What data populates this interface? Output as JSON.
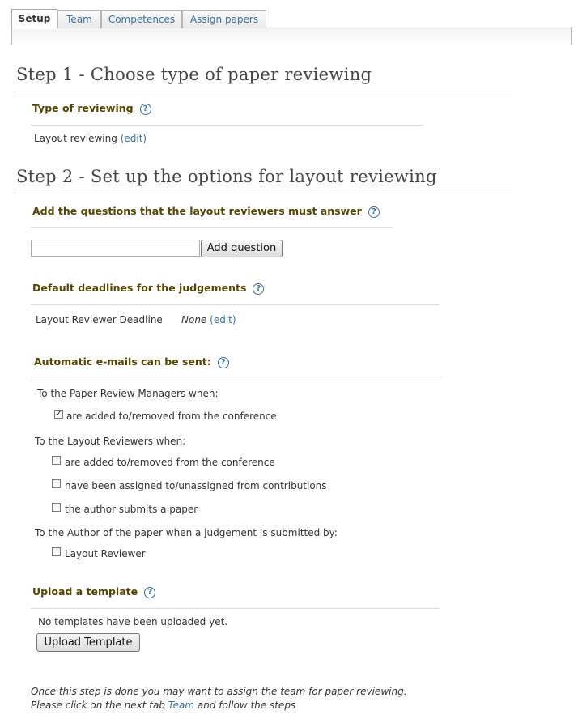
{
  "tabs": [
    {
      "label": "Setup",
      "active": true
    },
    {
      "label": "Team",
      "active": false
    },
    {
      "label": "Competences",
      "active": false
    },
    {
      "label": "Assign papers",
      "active": false
    }
  ],
  "step1": {
    "title": "Step 1 - Choose type of paper reviewing",
    "section_title": "Type of reviewing",
    "value": "Layout reviewing",
    "edit": "(edit)"
  },
  "step2": {
    "title": "Step 2 - Set up the options for layout reviewing",
    "questions": {
      "title": "Add the questions that the layout reviewers must answer",
      "input_value": "",
      "add_button": "Add question"
    },
    "deadlines": {
      "title": "Default deadlines for the judgements",
      "label": "Layout Reviewer Deadline",
      "value": "None",
      "edit": "(edit)"
    },
    "emails": {
      "title": "Automatic e-mails can be sent:",
      "group1": {
        "label": "To the Paper Review Managers when:",
        "items": [
          {
            "label": "are added to/removed from the conference",
            "checked": true
          }
        ]
      },
      "group2": {
        "label": "To the Layout Reviewers when:",
        "items": [
          {
            "label": "are added to/removed from the conference",
            "checked": false
          },
          {
            "label": "have been assigned to/unassigned from contributions",
            "checked": false
          },
          {
            "label": "the author submits a paper",
            "checked": false
          }
        ]
      },
      "group3": {
        "label": "To the Author of the paper when a judgement is submitted by:",
        "items": [
          {
            "label": "Layout Reviewer",
            "checked": false
          }
        ]
      }
    },
    "template": {
      "title": "Upload a template",
      "status": "No templates have been uploaded yet.",
      "upload_button": "Upload Template"
    }
  },
  "footer": {
    "note_part1": "Once this step is done you may want to assign the team for paper reviewing. Please click on the next tab",
    "note_link": "Team",
    "note_part2": "and follow the steps"
  },
  "help_icon": "help-question-icon",
  "colors": {
    "link": "#3a6f9a",
    "section_title": "#554400"
  }
}
